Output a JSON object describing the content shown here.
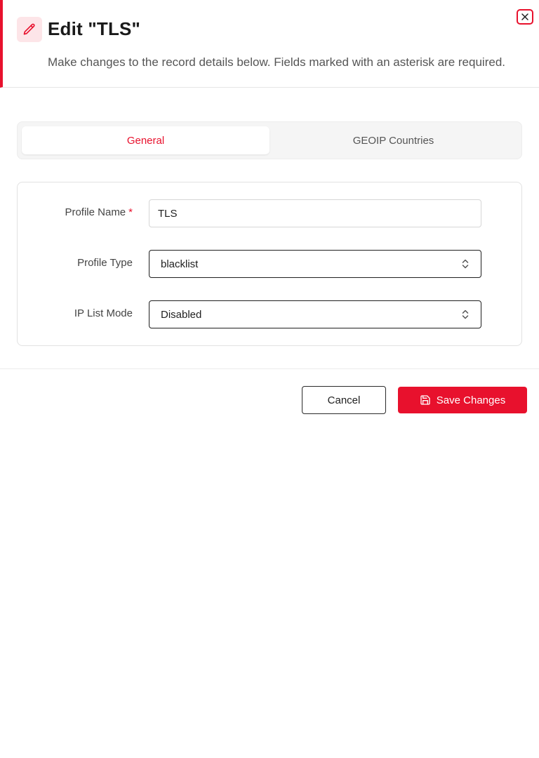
{
  "dialog": {
    "title": "Edit \"TLS\"",
    "subtitle": "Make changes to the record details below. Fields marked with an asterisk are required.",
    "header_icon": "pencil-icon",
    "close_icon": "close-icon",
    "accent_color": "#e8112d"
  },
  "tabs": [
    {
      "label": "General",
      "active": true
    },
    {
      "label": "GEOIP Countries",
      "active": false
    }
  ],
  "form": {
    "profile_name": {
      "label": "Profile Name",
      "required_mark": "*",
      "value": "TLS"
    },
    "profile_type": {
      "label": "Profile Type",
      "value": "blacklist"
    },
    "ip_list_mode": {
      "label": "IP List Mode",
      "value": "Disabled"
    }
  },
  "footer": {
    "cancel_label": "Cancel",
    "save_label": "Save Changes",
    "save_icon": "save-icon"
  }
}
